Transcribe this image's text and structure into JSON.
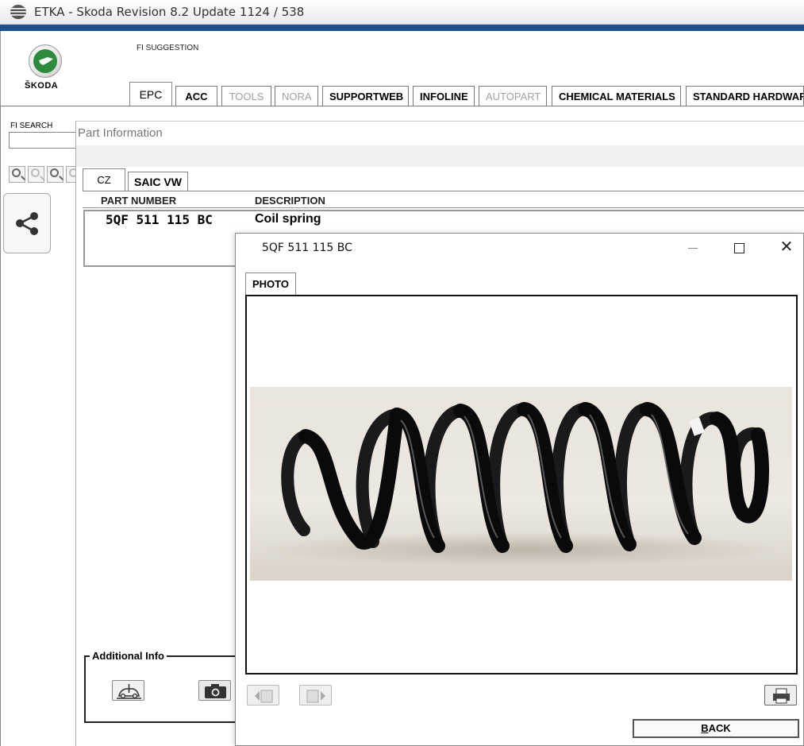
{
  "window": {
    "title": "ETKA - Skoda Revision 8.2 Update 1124 / 538"
  },
  "brand": {
    "name": "ŠKODA",
    "green": "#2e8b3d"
  },
  "header": {
    "fi_suggestion": "FI SUGGESTION"
  },
  "tabs": [
    {
      "label": "EPC",
      "state": "active"
    },
    {
      "label": "ACC",
      "state": "enabled"
    },
    {
      "label": "TOOLS",
      "state": "disabled"
    },
    {
      "label": "NORA",
      "state": "disabled"
    },
    {
      "label": "SUPPORTWEB",
      "state": "enabled"
    },
    {
      "label": "INFOLINE",
      "state": "enabled"
    },
    {
      "label": "AUTOPART",
      "state": "disabled"
    },
    {
      "label": "CHEMICAL MATERIALS",
      "state": "enabled"
    },
    {
      "label": "STANDARD HARDWAR",
      "state": "enabled"
    }
  ],
  "left": {
    "fi_search_label": "FI SEARCH",
    "fi_search_value": ""
  },
  "part_info": {
    "title": "Part Information",
    "tabs": [
      {
        "label": "CZ"
      },
      {
        "label": "SAIC VW"
      }
    ],
    "columns": {
      "part_number": "PART NUMBER",
      "description": "DESCRIPTION"
    },
    "rows": [
      {
        "part_number": "5QF 511 115 BC",
        "description": "Coil spring"
      }
    ],
    "additional_info_label": "Additional Info"
  },
  "dialog": {
    "title": "5QF 511 115 BC",
    "tab_label": "PHOTO",
    "back_label_first": "B",
    "back_label_rest": "ACK",
    "photo_subject": "coil-spring"
  }
}
